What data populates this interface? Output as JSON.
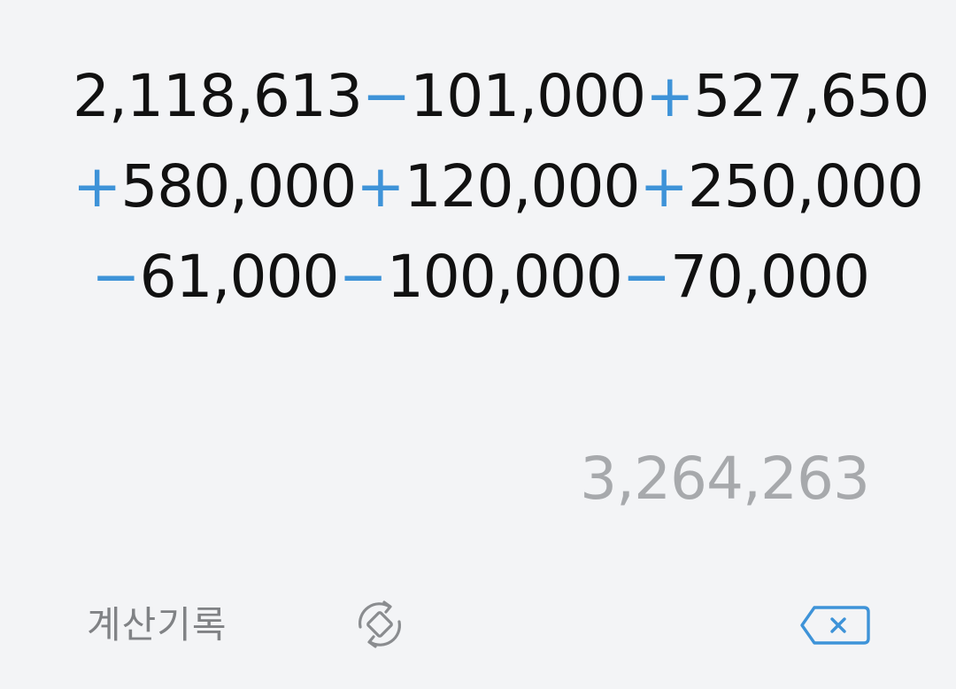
{
  "expression": {
    "lines": [
      [
        {
          "text": "2,118,613",
          "kind": "num"
        },
        {
          "text": "−",
          "kind": "op"
        },
        {
          "text": "101,000",
          "kind": "num"
        },
        {
          "text": "+",
          "kind": "op"
        },
        {
          "text": "527,650",
          "kind": "num"
        }
      ],
      [
        {
          "text": "+",
          "kind": "op"
        },
        {
          "text": "580,000",
          "kind": "num"
        },
        {
          "text": "+",
          "kind": "op"
        },
        {
          "text": "120,000",
          "kind": "num"
        },
        {
          "text": "+",
          "kind": "op"
        },
        {
          "text": "250,000",
          "kind": "num"
        }
      ],
      [
        {
          "text": "−",
          "kind": "op"
        },
        {
          "text": "61,000",
          "kind": "num"
        },
        {
          "text": "−",
          "kind": "op"
        },
        {
          "text": "100,000",
          "kind": "num"
        },
        {
          "text": "−",
          "kind": "op"
        },
        {
          "text": "70,000",
          "kind": "num"
        }
      ]
    ]
  },
  "result": "3,264,263",
  "controls": {
    "history_label": "계산기록",
    "rotate_icon": "rotate-icon",
    "backspace_icon": "backspace-icon"
  },
  "colors": {
    "background": "#f3f4f6",
    "operator": "#3e93d8",
    "number": "#111111",
    "result": "#a7a9ac",
    "history": "#808285"
  }
}
